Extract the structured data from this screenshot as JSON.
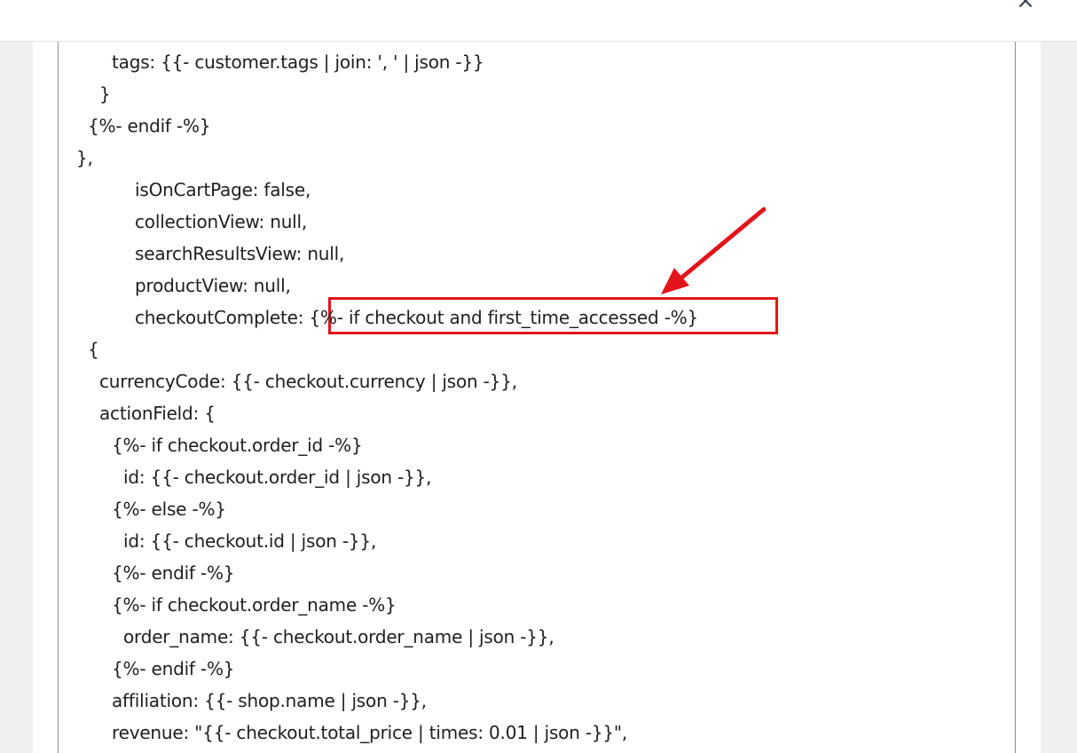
{
  "dialog": {
    "close_label": "×"
  },
  "code": {
    "lines": [
      {
        "indent": 60,
        "text": "tags: {{- customer.tags | join: ', ' | json -}}"
      },
      {
        "indent": 46,
        "text": "}"
      },
      {
        "indent": 33,
        "text": "{%- endif -%}"
      },
      {
        "indent": 20,
        "text": "},"
      },
      {
        "indent": 86,
        "text": "isOnCartPage: false,"
      },
      {
        "indent": 86,
        "text": "collectionView: null,"
      },
      {
        "indent": 86,
        "text": "searchResultsView: null,"
      },
      {
        "indent": 86,
        "text": "productView: null,"
      },
      {
        "indent": 86,
        "text": "checkoutComplete: {%- if checkout and first_time_accessed -%}"
      },
      {
        "indent": 33,
        "text": "{"
      },
      {
        "indent": 46,
        "text": "currencyCode: {{- checkout.currency | json -}},"
      },
      {
        "indent": 46,
        "text": "actionField: {"
      },
      {
        "indent": 60,
        "text": "{%- if checkout.order_id -%}"
      },
      {
        "indent": 73,
        "text": "id: {{- checkout.order_id | json -}},"
      },
      {
        "indent": 60,
        "text": "{%- else -%}"
      },
      {
        "indent": 73,
        "text": "id: {{- checkout.id | json -}},"
      },
      {
        "indent": 60,
        "text": "{%- endif -%}"
      },
      {
        "indent": 60,
        "text": "{%- if checkout.order_name -%}"
      },
      {
        "indent": 73,
        "text": "order_name: {{- checkout.order_name | json -}},"
      },
      {
        "indent": 60,
        "text": "{%- endif -%}"
      },
      {
        "indent": 60,
        "text": "affiliation: {{- shop.name | json -}},"
      },
      {
        "indent": 60,
        "text": "revenue: \"{{- checkout.total_price | times: 0.01 | json -}}\","
      }
    ]
  },
  "colors": {
    "annotation": "#e3141a",
    "text": "#1e1e1e",
    "background": "#f0f0f1"
  }
}
